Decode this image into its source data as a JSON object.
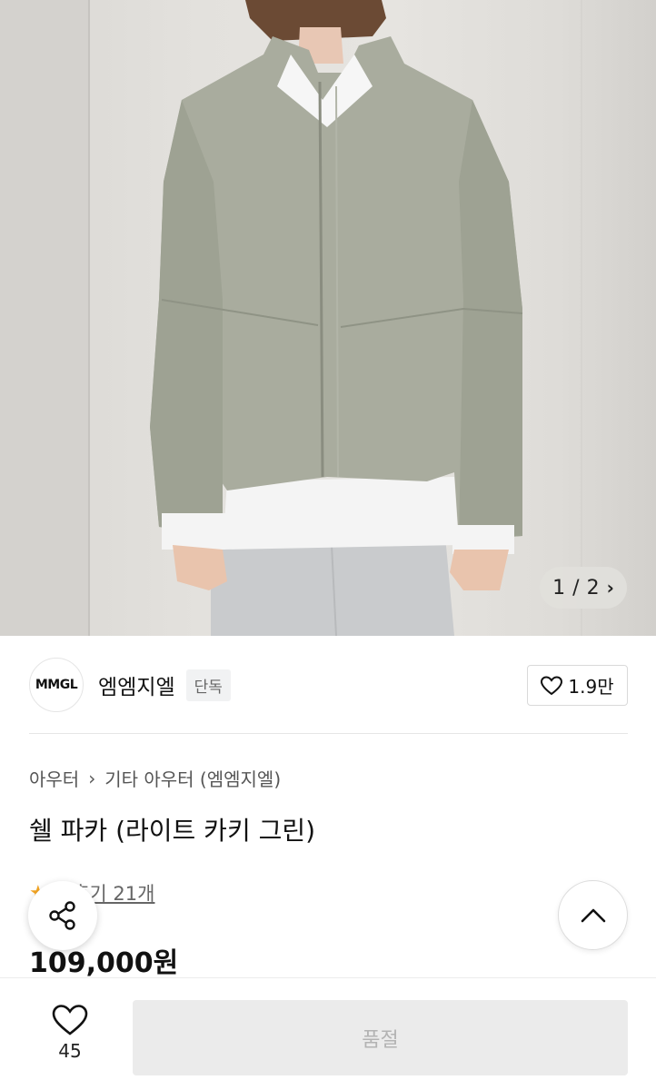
{
  "gallery": {
    "current": "1",
    "separator": "/",
    "total": "2",
    "next_icon": "chevron-right-icon"
  },
  "brand": {
    "logo_text": "MMGL",
    "name": "엠엠지엘",
    "tag": "단독",
    "likes": "1.9만"
  },
  "product": {
    "breadcrumb": [
      "아우터",
      "기타 아우터 (엠엠지엘)"
    ],
    "title": "쉘 파카 (라이트 카키 그린)",
    "rating": "5",
    "reviews": "후기 21개",
    "price": "109,000원"
  },
  "bottom_bar": {
    "wish_count": "45",
    "buy_label": "품절"
  },
  "colors": {
    "accent_star": "#f5a623",
    "disabled_button": "#ebebeb",
    "disabled_text": "#b3b3b3"
  }
}
